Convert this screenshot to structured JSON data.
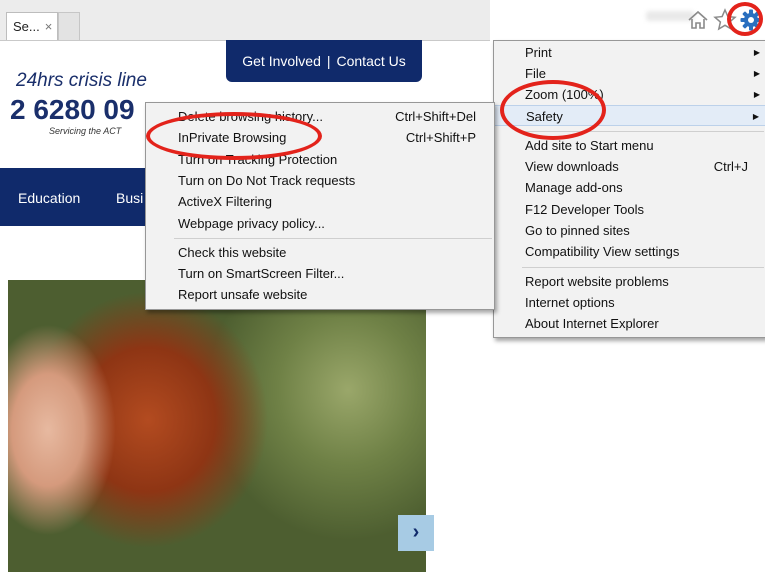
{
  "browser": {
    "tab_title": "Se...",
    "tab_close": "×",
    "toolbar_icons": [
      "home-icon",
      "star-icon",
      "gear-icon"
    ]
  },
  "site": {
    "nav_top": [
      "Get Involved",
      "Contact Us"
    ],
    "nav_separator": "|",
    "crisis_label": "24hrs crisis line",
    "crisis_number": "2 6280 09",
    "servicing": "Servicing the ACT",
    "nav_items": [
      "Education",
      "Busi"
    ],
    "next_arrow": "›",
    "colors": {
      "navy": "#102a6b",
      "arrow_bg": "#a7cbe4"
    }
  },
  "tools_menu": {
    "items": [
      {
        "label": "Print",
        "submenu": true
      },
      {
        "label": "File",
        "submenu": true
      },
      {
        "label": "Zoom (100%)",
        "submenu": true
      },
      {
        "label": "Safety",
        "submenu": true,
        "highlighted": true
      },
      {
        "label": "Add site to Start menu"
      },
      {
        "label": "View downloads",
        "shortcut": "Ctrl+J"
      },
      {
        "label": "Manage add-ons"
      },
      {
        "label": "F12 Developer Tools"
      },
      {
        "label": "Go to pinned sites"
      },
      {
        "label": "Compatibility View settings"
      },
      {
        "label": "Report website problems"
      },
      {
        "label": "Internet options"
      },
      {
        "label": "About Internet Explorer"
      }
    ]
  },
  "safety_menu": {
    "items": [
      {
        "label": "Delete browsing history...",
        "shortcut": "Ctrl+Shift+Del"
      },
      {
        "label": "InPrivate Browsing",
        "shortcut": "Ctrl+Shift+P"
      },
      {
        "label": "Turn on Tracking Protection"
      },
      {
        "label": "Turn on Do Not Track requests"
      },
      {
        "label": "ActiveX Filtering"
      },
      {
        "label": "Webpage privacy policy..."
      },
      {
        "label": "Check this website"
      },
      {
        "label": "Turn on SmartScreen Filter..."
      },
      {
        "label": "Report unsafe website"
      }
    ]
  },
  "annotation_color": "#e3231b"
}
